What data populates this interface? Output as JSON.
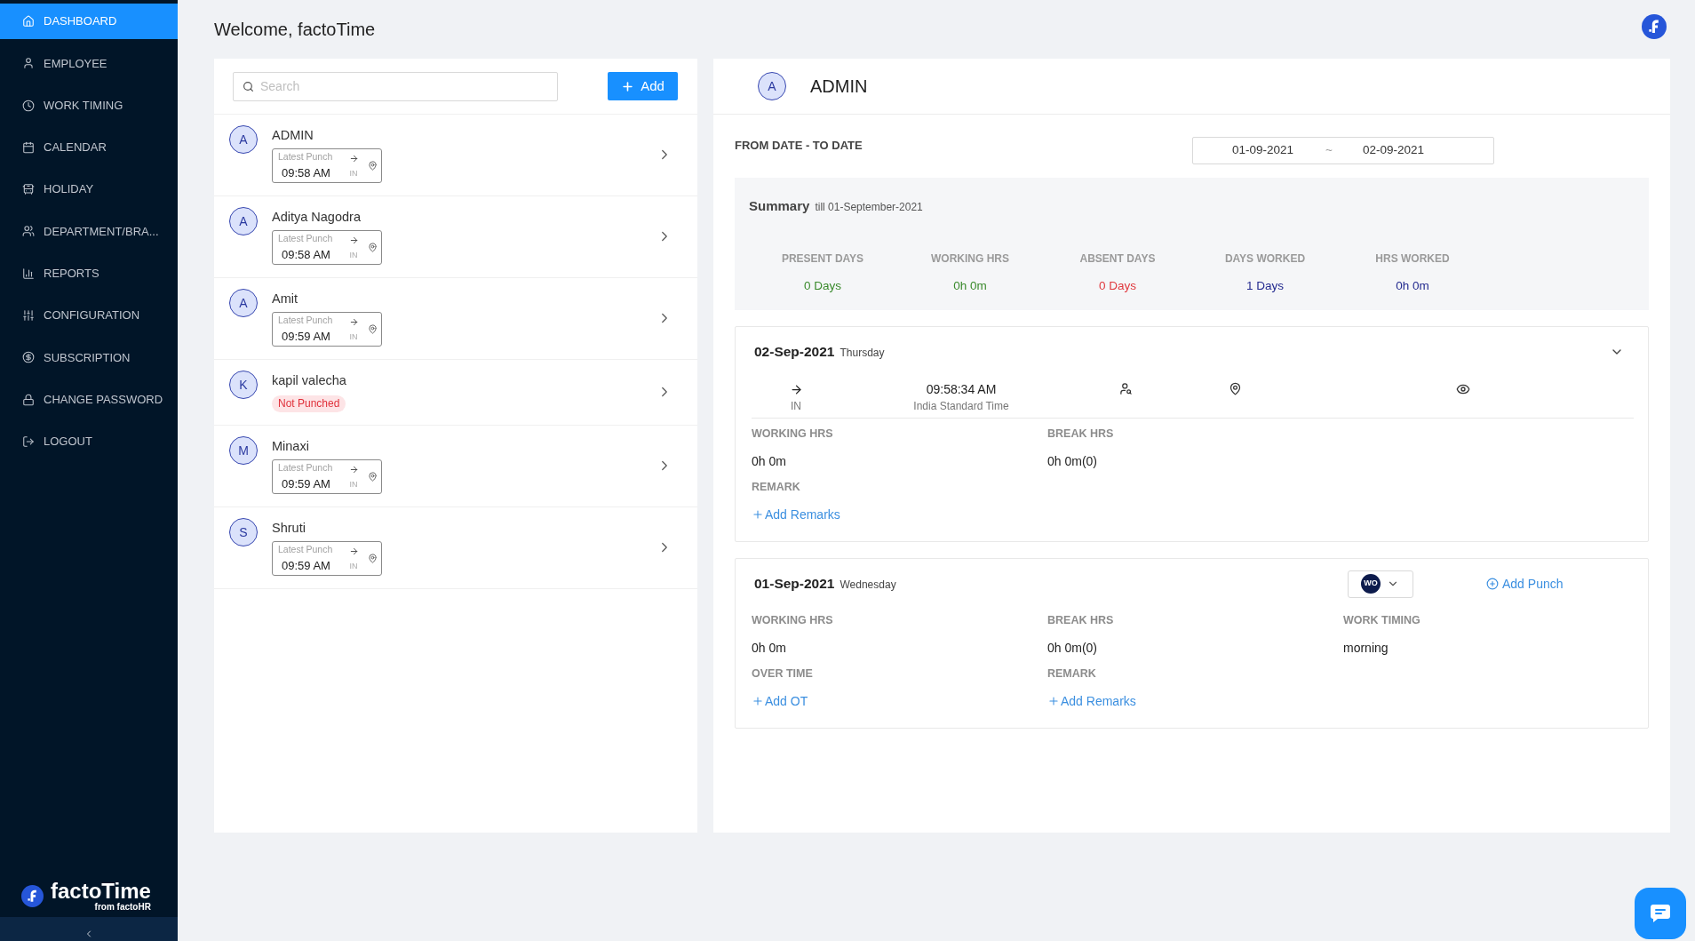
{
  "sidebar": {
    "items": [
      {
        "label": "DASHBOARD",
        "selected": true
      },
      {
        "label": "EMPLOYEE",
        "selected": false
      },
      {
        "label": "WORK TIMING",
        "selected": false
      },
      {
        "label": "CALENDAR",
        "selected": false
      },
      {
        "label": "HOLIDAY",
        "selected": false
      },
      {
        "label": "DEPARTMENT/BRA...",
        "selected": false
      },
      {
        "label": "REPORTS",
        "selected": false
      },
      {
        "label": "CONFIGURATION",
        "selected": false
      },
      {
        "label": "SUBSCRIPTION",
        "selected": false
      },
      {
        "label": "CHANGE PASSWORD",
        "selected": false
      },
      {
        "label": "LOGOUT",
        "selected": false
      }
    ],
    "brand": {
      "name": "factoTime",
      "tagline": "from factoHR"
    }
  },
  "header": {
    "title": "Welcome, factoTime"
  },
  "employee_list": {
    "search": {
      "placeholder": "Search"
    },
    "add_button": "Add",
    "employees": [
      {
        "initial": "A",
        "name": "ADMIN",
        "punch": {
          "label": "Latest Punch",
          "time": "09:58 AM",
          "direction": "IN"
        }
      },
      {
        "initial": "A",
        "name": "Aditya Nagodra",
        "punch": {
          "label": "Latest Punch",
          "time": "09:58 AM",
          "direction": "IN"
        }
      },
      {
        "initial": "A",
        "name": "Amit",
        "punch": {
          "label": "Latest Punch",
          "time": "09:59 AM",
          "direction": "IN"
        }
      },
      {
        "initial": "K",
        "name": "kapil valecha",
        "status": "Not Punched"
      },
      {
        "initial": "M",
        "name": "Minaxi",
        "punch": {
          "label": "Latest Punch",
          "time": "09:59 AM",
          "direction": "IN"
        }
      },
      {
        "initial": "S",
        "name": "Shruti",
        "punch": {
          "label": "Latest Punch",
          "time": "09:59 AM",
          "direction": "IN"
        }
      }
    ]
  },
  "detail": {
    "initial": "A",
    "name": "ADMIN",
    "date_range": {
      "label": "FROM DATE - TO DATE",
      "from": "01-09-2021",
      "separator": "~",
      "to": "02-09-2021"
    },
    "summary": {
      "title": "Summary",
      "subtitle": "till 01-September-2021",
      "stats": [
        {
          "label": "PRESENT DAYS",
          "value": "0 Days",
          "color": "#3a8a2c"
        },
        {
          "label": "WORKING HRS",
          "value": "0h 0m",
          "color": "#3a8a2c"
        },
        {
          "label": "ABSENT DAYS",
          "value": "0 Days",
          "color": "#e0393e"
        },
        {
          "label": "DAYS WORKED",
          "value": "1 Days",
          "color": "#232a8f"
        },
        {
          "label": "HRS WORKED",
          "value": "0h 0m",
          "color": "#232a8f"
        }
      ]
    },
    "days": [
      {
        "date": "02-Sep-2021",
        "weekday": "Thursday",
        "punches": [
          {
            "direction": "IN",
            "time": "09:58:34 AM",
            "zone": "India Standard Time"
          }
        ],
        "rows": [
          [
            {
              "label": "WORKING HRS",
              "value": "0h 0m"
            },
            {
              "label": "BREAK HRS",
              "value": "0h 0m(0)"
            }
          ],
          [
            {
              "label": "REMARK",
              "action": "Add Remarks"
            }
          ]
        ]
      },
      {
        "date": "01-Sep-2021",
        "weekday": "Wednesday",
        "badge": "WO",
        "add_punch": "Add Punch",
        "rows": [
          [
            {
              "label": "WORKING HRS",
              "value": "0h 0m"
            },
            {
              "label": "BREAK HRS",
              "value": "0h 0m(0)"
            },
            {
              "label": "WORK TIMING",
              "value": "morning"
            }
          ],
          [
            {
              "label": "OVER TIME",
              "action": "Add OT"
            },
            {
              "label": "REMARK",
              "action": "Add Remarks"
            }
          ]
        ]
      }
    ]
  }
}
